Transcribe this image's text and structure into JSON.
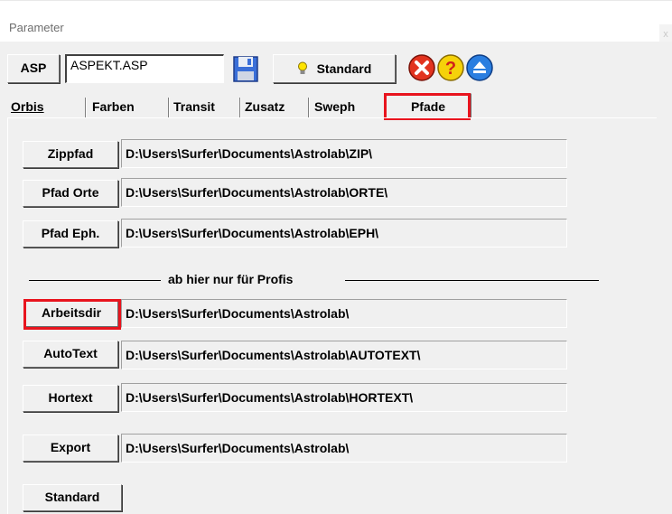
{
  "window": {
    "title": "Parameter",
    "close_glyph": "x"
  },
  "toolbar": {
    "mode_label": "ASP",
    "file_value": "ASPEKT.ASP",
    "save_icon": "floppy-disk-icon",
    "standard_label": "Standard",
    "standard_icon": "lightbulb-icon",
    "cancel_icon": "cancel-icon",
    "help_icon": "help-icon",
    "eject_icon": "eject-icon"
  },
  "tabs": [
    "Orbis",
    "Farben",
    "Transit",
    "Zusatz",
    "Sweph",
    "Pfade"
  ],
  "active_tab": "Pfade",
  "paths": {
    "zippfad": {
      "label": "Zippfad",
      "value": "D:\\Users\\Surfer\\Documents\\Astrolab\\ZIP\\"
    },
    "orte": {
      "label": "Pfad Orte",
      "value": "D:\\Users\\Surfer\\Documents\\Astrolab\\ORTE\\"
    },
    "eph": {
      "label": "Pfad Eph.",
      "value": "D:\\Users\\Surfer\\Documents\\Astrolab\\EPH\\"
    },
    "arbeitsdir": {
      "label": "Arbeitsdir",
      "value": "D:\\Users\\Surfer\\Documents\\Astrolab\\"
    },
    "autotext": {
      "label": "AutoText",
      "value": "D:\\Users\\Surfer\\Documents\\Astrolab\\AUTOTEXT\\"
    },
    "hortext": {
      "label": "Hortext",
      "value": "D:\\Users\\Surfer\\Documents\\Astrolab\\HORTEXT\\"
    },
    "export": {
      "label": "Export",
      "value": "D:\\Users\\Surfer\\Documents\\Astrolab\\"
    }
  },
  "separator_text": "ab hier nur für Profis",
  "standard_button": "Standard",
  "colors": {
    "highlight_red": "#e8141e",
    "window_bg": "#f0f0f0"
  }
}
